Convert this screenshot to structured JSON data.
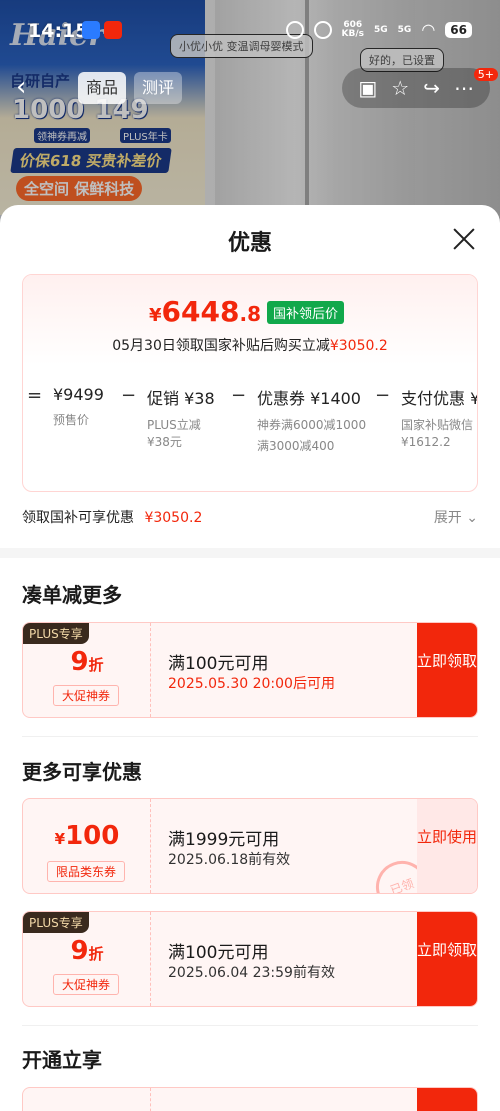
{
  "status_bar": {
    "time": "14:15",
    "net_speed_value": "606",
    "net_speed_unit": "KB/s",
    "sig1": "5G",
    "sig2": "5G",
    "battery": "66"
  },
  "background": {
    "logo": "Haier",
    "promo_line": "自研自产 ",
    "side_label": "领神券",
    "promo_value_1": "1000",
    "promo_value_2": "149",
    "promo_sub_1": "领神券再减",
    "promo_sub_2": "PLUS年卡",
    "ribbon": "价保618 买贵补差价",
    "ribbon2": "全空间 保鲜科技",
    "bubble1": "小优小优 变温调母婴模式",
    "bubble2": "好的，已设置",
    "cart_badge": "5+"
  },
  "product_nav": {
    "tab_product": "商品",
    "tab_review": "测评"
  },
  "sheet": {
    "title": "优惠",
    "price_card": {
      "currency": "¥",
      "price_int": "6448",
      "price_dec": ".8",
      "tag": "国补领后价",
      "note_prefix": "05月30日领取国家补贴后购买立减",
      "note_amount": "¥3050.2",
      "calc": [
        {
          "op": "=",
          "main": "¥9499",
          "sub": "预售价"
        },
        {
          "op": "−",
          "main": "促销 ¥38",
          "sub": "PLUS立减 ¥38元"
        },
        {
          "op": "−",
          "main": "优惠券 ¥1400",
          "sub": "神券满6000减1000",
          "sub2": "满3000减400"
        },
        {
          "op": "−",
          "main": "支付优惠 ¥",
          "sub": "国家补贴微信 ¥1612.2"
        }
      ]
    },
    "claim": {
      "label": "领取国补可享优惠",
      "amount": "¥3050.2",
      "expand": "展开"
    },
    "section1": {
      "title": "凑单减更多",
      "coupon": {
        "plus": "PLUS专享",
        "disc_big": "9",
        "disc_small": "折",
        "type": "大促神券",
        "condition": "满100元可用",
        "date": "2025.05.30 20:00后可用",
        "button": "立即领取"
      }
    },
    "section2": {
      "title": "更多可享优惠",
      "coupons": [
        {
          "currency": "¥",
          "amount": "100",
          "type": "限品类东券",
          "condition": "满1999元可用",
          "date": "2025.06.18前有效",
          "button": "立即使用",
          "stamp": "已领"
        },
        {
          "plus": "PLUS专享",
          "disc_big": "9",
          "disc_small": "折",
          "type": "大促神券",
          "condition": "满100元可用",
          "date": "2025.06.04 23:59前有效",
          "button": "立即领取"
        }
      ]
    },
    "section3": {
      "title": "开通立享"
    }
  },
  "colors": {
    "accent_red": "#f2270c",
    "green_tag": "#11a84b",
    "plus_dark": "#3a2a1e"
  }
}
